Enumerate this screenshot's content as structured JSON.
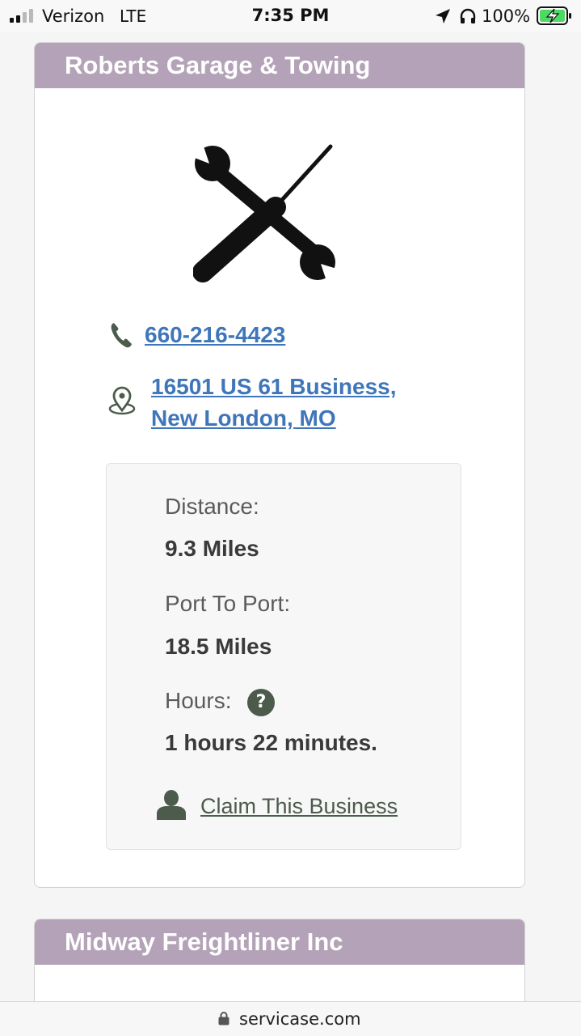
{
  "status_bar": {
    "carrier": "Verizon",
    "network": "LTE",
    "time": "7:35 PM",
    "battery_percent": "100%",
    "signal_bars": 2,
    "signal_total": 4,
    "charging": true,
    "icons": [
      "signal-bars-icon",
      "location-arrow-icon",
      "headphones-icon",
      "battery-charging-icon"
    ]
  },
  "listings": [
    {
      "name": "Roberts Garage & Towing",
      "image_icon": "wrench-screwdriver-icon",
      "phone": "660-216-4423",
      "address_line1": "16501 US 61 Business,",
      "address_line2": "New London, MO",
      "details": {
        "distance_label": "Distance:",
        "distance_value": "9.3 Miles",
        "port_label": "Port To Port:",
        "port_value": "18.5 Miles",
        "hours_label": "Hours:",
        "hours_help_icon": "question-circle-icon",
        "hours_help_glyph": "?",
        "hours_value": "1 hours 22 minutes.",
        "claim_icon": "user-icon",
        "claim_label": "Claim This Business"
      }
    },
    {
      "name": "Midway Freightliner Inc"
    }
  ],
  "url_bar": {
    "domain": "servicase.com",
    "secure": true
  },
  "colors": {
    "card_header_bg": "#b4a3b8",
    "link_blue": "#3f76ba",
    "icon_green": "#4c5b4c",
    "battery_green": "#4cd964"
  }
}
